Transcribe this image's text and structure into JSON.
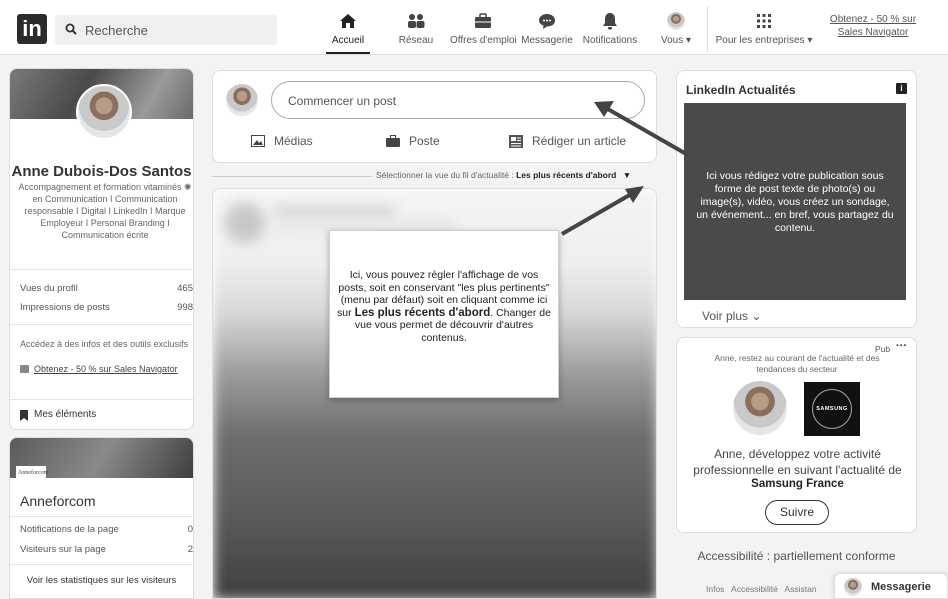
{
  "header": {
    "logo": "in",
    "search_placeholder": "Recherche",
    "nav": [
      {
        "label": "Accueil"
      },
      {
        "label": "Réseau"
      },
      {
        "label": "Offres d'emploi"
      },
      {
        "label": "Messagerie"
      },
      {
        "label": "Notifications"
      },
      {
        "label": "Vous ▾"
      },
      {
        "label": "Pour les entreprises ▾"
      }
    ],
    "premium_link": "Obtenez - 50 % sur Sales Navigator"
  },
  "profile": {
    "name": "Anne Dubois-Dos Santos",
    "headline": "Accompagnement et formation vitaminés ✺ en Communication I Communication responsable I Digital I LinkedIn I Marque Employeur I Personal Branding I Communication écrite",
    "stats": [
      {
        "label": "Vues du profil",
        "value": "465"
      },
      {
        "label": "Impressions de posts",
        "value": "998"
      }
    ],
    "premium_text": "Accédez à des infos et des outils exclusifs",
    "premium_link": "Obtenez - 50 % sur Sales Navigator",
    "my_items": "Mes éléments"
  },
  "page_card": {
    "banner_text": "Anneforcom",
    "title": "Anneforcom",
    "stats": [
      {
        "label": "Notifications de la page",
        "value": "0"
      },
      {
        "label": "Visiteurs sur la page",
        "value": "2"
      }
    ],
    "link": "Voir les statistiques sur les visiteurs"
  },
  "composer": {
    "placeholder": "Commencer un post",
    "actions": [
      {
        "label": "Médias"
      },
      {
        "label": "Poste"
      },
      {
        "label": "Rédiger un article"
      }
    ]
  },
  "feed_sort": {
    "label": "Sélectionner la vue du fil d'actualité :",
    "value": "Les plus récents d'abord"
  },
  "callout_center": {
    "part1": "Ici, vous pouvez régler l'affichage de vos posts, soit en conservant \"les plus pertinents\" (menu par défaut) soit en cliquant comme ici sur ",
    "bold": "Les plus récents d'abord",
    "part2": ". Changer de vue vous permet de découvrir d'autres contenus."
  },
  "news": {
    "title": "LinkedIn Actualités",
    "callout": "Ici vous rédigez votre publication sous forme de post texte de photo(s) ou image(s), vidéo, vous créez un sondage, un événement... en bref, vous partagez du contenu.",
    "see_more": "Voir plus"
  },
  "ad": {
    "badge": "Pub",
    "subtitle": "Anne, restez au courant de l'actualité et des tendances du secteur",
    "brand": "SAMSUNG",
    "text": "Anne, développez votre activité professionnelle en suivant l'actualité de",
    "company": "Samsung France",
    "follow": "Suivre"
  },
  "footer": {
    "accessibility": "Accessibilité : partiellement conforme",
    "links": "Infos   Accessibilité   Assistan",
    "messaging": "Messagerie"
  }
}
